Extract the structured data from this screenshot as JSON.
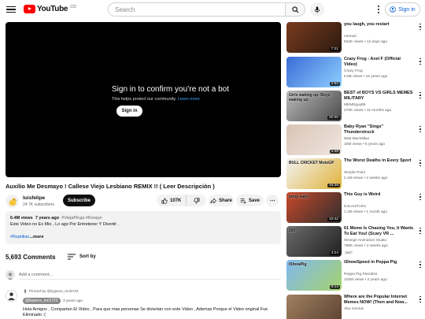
{
  "header": {
    "logo_text": "YouTube",
    "logo_suffix": "CO",
    "search_placeholder": "Search",
    "signin_label": "Sign in"
  },
  "player": {
    "title": "Sign in to confirm you’re not a bot",
    "subtitle": "This helps protect our community.",
    "learn_more": "Learn more",
    "signin_button": "Sign in"
  },
  "video": {
    "title": "Auxilio Me Desmayo ! Callese Viejo Lesbiano REMIX !! ( Leer Descripción )",
    "channel": "luisfelipe",
    "subscribers": "24.7K subscribers",
    "subscribe_label": "Subscribe",
    "likes": "107K",
    "share_label": "Share",
    "save_label": "Save"
  },
  "description": {
    "views": "6.4M views",
    "age": "7 years ago",
    "tags": "#ViejaPiruja #Korayo",
    "line1": "Este Video no Es Mio , Lo ago Por Entretener Y Divertir .",
    "hashtag": "#Reptilian",
    "more": "...more"
  },
  "comments": {
    "count": "5,693 Comments",
    "sort_label": "Sort by",
    "placeholder": "Add a comment...",
    "pinned_label": "Pinned by @bypexx_mc5723",
    "author": "@bypexx_mc5723",
    "time": "3 years ago",
    "text": "Hola Amigos , Compartan El Video , Para que mas personas Se diviertan con este Video , Ademas Porque el Video original Fue Eliminado :("
  },
  "recommendations": [
    {
      "title": "you laugh, you restart",
      "channel": "memari",
      "meta": "942K views • 12 days ago",
      "duration": "7:21",
      "colors": [
        "#7a3b1f",
        "#2b1a0f"
      ]
    },
    {
      "title": "Crazy Frog - Axel F (Official Video)",
      "channel": "Crazy Frog",
      "meta": "5.6B views • 16 years ago",
      "duration": "2:52",
      "colors": [
        "#3a6bd6",
        "#8fd0ff"
      ]
    },
    {
      "title": "BEST of BOYS VS GIRLS MEMES MILITARY",
      "channel": "MEMEguy69",
      "meta": "270K views • 11 months ago",
      "duration": "20:00",
      "colors": [
        "#b9b9b9",
        "#4a4a4a"
      ],
      "thumb_text": "Girls waking up:   Boys waking up:"
    },
    {
      "title": "Baby Ryan \"Sings\" Thunderstruck",
      "channel": "Matt MacMillan",
      "meta": "10M views • 5 years ago",
      "duration": "1:46",
      "colors": [
        "#d9c4b5",
        "#f0e6e0"
      ]
    },
    {
      "title": "The Worst Deaths in Every Sport",
      "channel": "Simple Paint",
      "meta": "2.1M views • 2 weeks ago",
      "duration": "16:26",
      "colors": [
        "#f2f2f2",
        "#e0b33a"
      ],
      "thumb_text": "BULL   CRICKET   MotoGP"
    },
    {
      "title": "This Guy is Weird",
      "channel": "DJLoveTurks",
      "meta": "1.1M views • 1 month ago",
      "duration": "10:42",
      "colors": [
        "#c8482a",
        "#2e2e2e"
      ],
      "thumb_text": "poop eater"
    },
    {
      "title": "61 Meme Is Chasing You, It Wants To Eat You! (Scary VR ...",
      "channel": "Strange Animation Studio",
      "meta": "786K views • 2 weeks ago",
      "duration": "4:24",
      "badge": "360°",
      "colors": [
        "#6b6b6b",
        "#202020"
      ],
      "thumb_text": "360°"
    },
    {
      "title": "iShowSpeed in Peppa Pig",
      "channel": "Peppa Pig Parodies",
      "meta": "125M views • 2 years ago",
      "duration": "6:14",
      "colors": [
        "#7fb8f0",
        "#a6d36b"
      ],
      "thumb_text": "iShowPig"
    },
    {
      "title": "Where are the Popular Internet Memes NOW! (Then and Now...",
      "channel": "Abu Genius",
      "meta": "",
      "duration": "",
      "colors": [
        "#a08060",
        "#5a4030"
      ]
    }
  ]
}
